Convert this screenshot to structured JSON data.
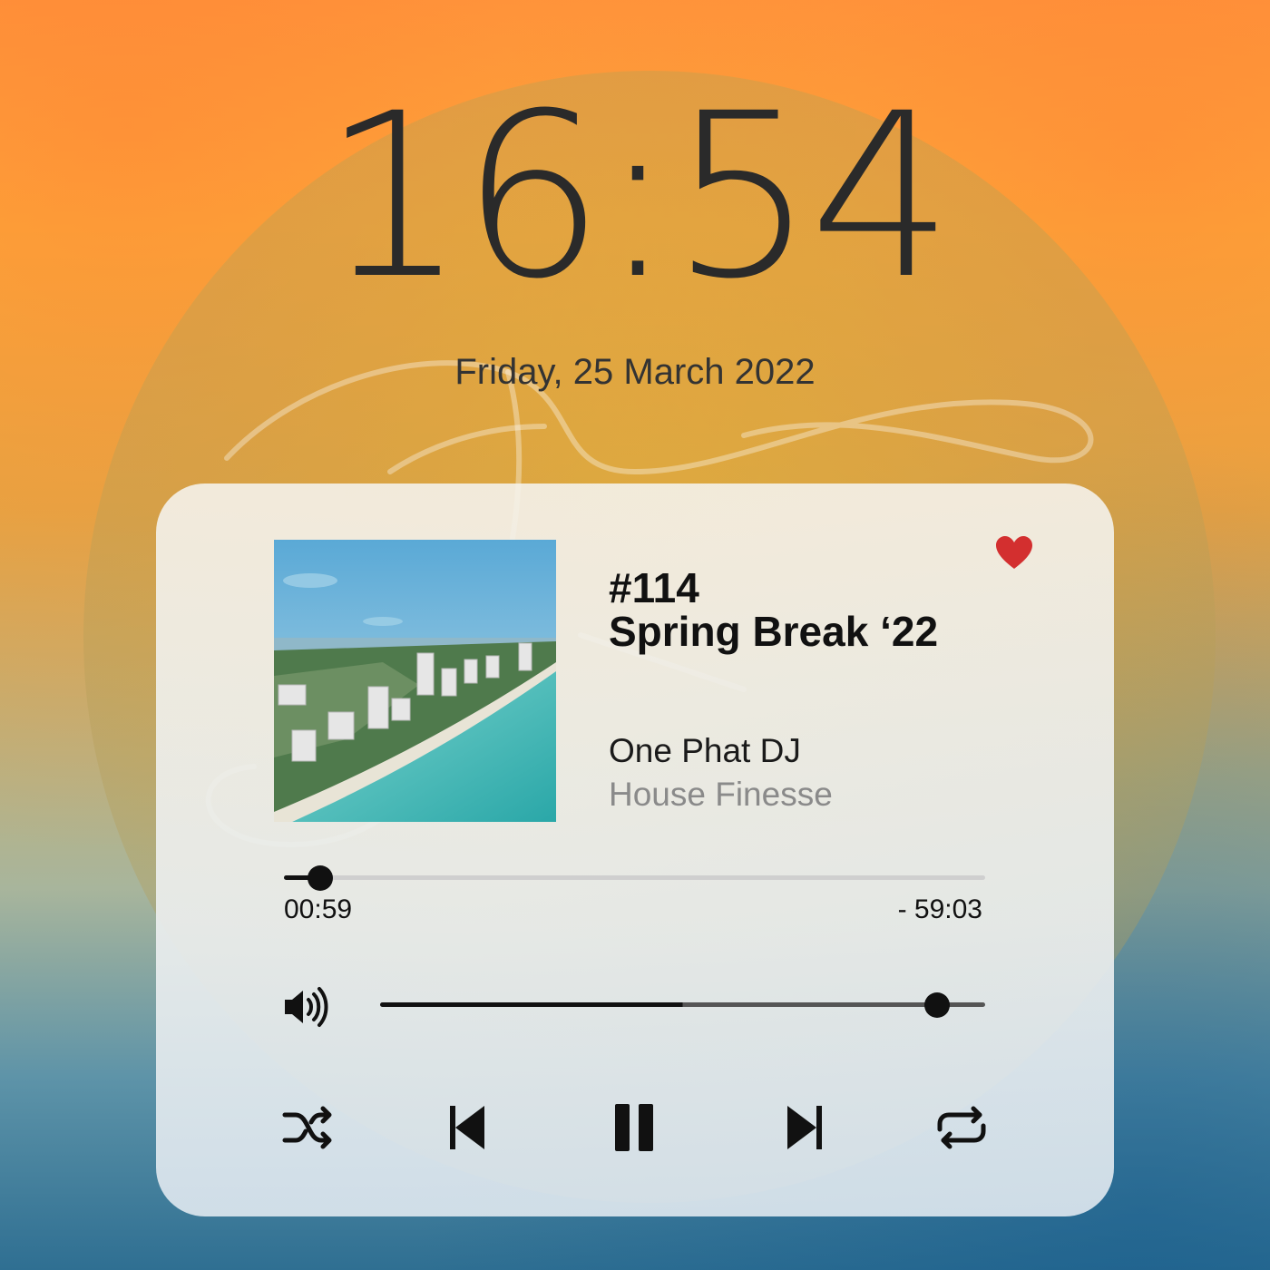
{
  "lockscreen": {
    "time": "16:54",
    "date": "Friday, 25 March 2022"
  },
  "player": {
    "episode": "#114",
    "title": "Spring Break ‘22",
    "artist": "One Phat DJ",
    "show": "House Finesse",
    "favorite": true,
    "heart_color": "#d32f2f",
    "progress": {
      "elapsed": "00:59",
      "remaining": "- 59:03",
      "fraction": 0.052
    },
    "volume": {
      "fraction": 0.92
    },
    "controls": [
      "shuffle-icon",
      "previous-icon",
      "pause-icon",
      "next-icon",
      "repeat-icon"
    ]
  }
}
